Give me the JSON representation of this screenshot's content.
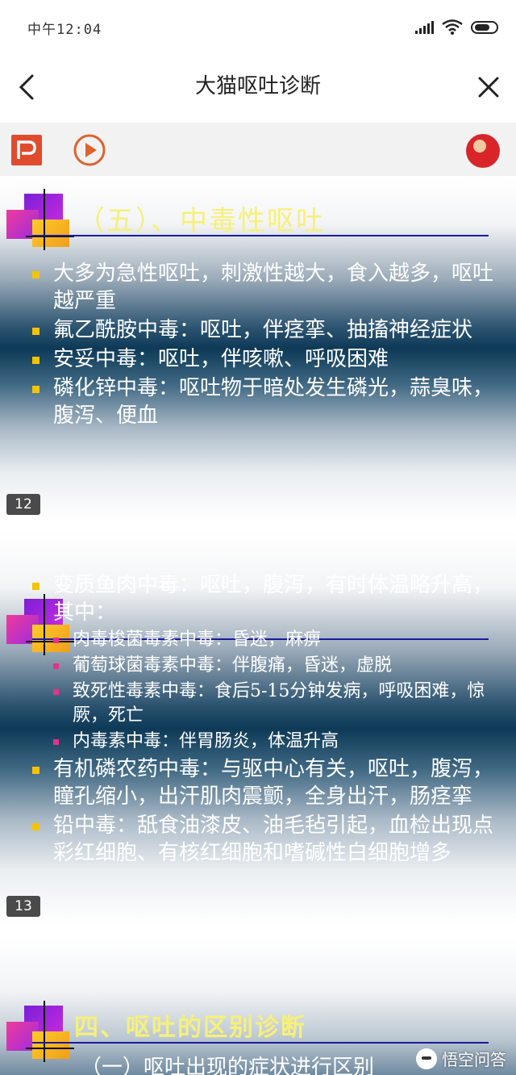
{
  "status_bar": {
    "time": "中午12:04"
  },
  "nav": {
    "title": "大猫呕吐诊断"
  },
  "colors": {
    "slide_title_yellow": "#f6f07a",
    "bullet_text": "#ffffff",
    "bullet_square": "#f5c400",
    "sub_bullet_square": "#e8308a",
    "title_rule": "#1a1aa0",
    "ppt_icon": "#e04b2e",
    "play_icon": "#e0622e"
  },
  "toolbar": {
    "ppt_icon": "ppt-icon",
    "play_icon": "play-icon",
    "avatar": "user-avatar"
  },
  "slides": [
    {
      "title": "（五）、中毒性呕吐",
      "bullets": [
        "大多为急性呕吐，刺激性越大，食入越多，呕吐越严重",
        "氟乙酰胺中毒：呕吐，伴痉挛、抽搐神经症状",
        "安妥中毒：呕吐，伴咳嗽、呼吸困难",
        "磷化锌中毒：呕吐物于暗处发生磷光，蒜臭味，腹泻、便血"
      ],
      "page": "12"
    },
    {
      "bullets": [
        "变质鱼肉中毒：呕吐，腹泻，有时体温略升高，其中：",
        "肉毒梭菌毒素中毒：昏迷，麻痹",
        "葡萄球菌毒素中毒：伴腹痛，昏迷，虚脱",
        "致死性毒素中毒：食后5-15分钟发病，呼吸困难，惊厥，死亡",
        "内毒素中毒：伴胃肠炎，体温升高",
        "有机磷农药中毒：与驱中心有关，呕吐，腹泻，瞳孔缩小，出汗肌肉震颤，全身出汗，肠痉挛",
        "铅中毒：舐食油漆皮、油毛毡引起，血检出现点彩红细胞、有核红细胞和嗜碱性白细胞增多"
      ],
      "page": "13"
    },
    {
      "title": "四、呕吐的区别诊断",
      "subtitle": "（一）呕吐出现的症状进行区别",
      "watermark": "悟空问答"
    }
  ]
}
